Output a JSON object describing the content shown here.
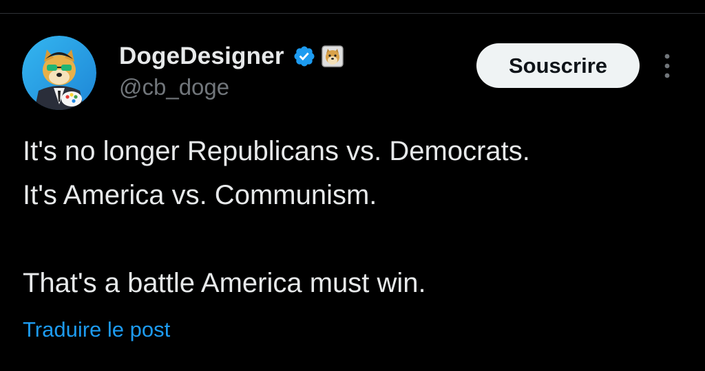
{
  "post": {
    "author": {
      "display_name": "DogeDesigner",
      "handle": "@cb_doge",
      "verified": true,
      "verified_badge_icon": "verified-checkmark-icon",
      "affiliate_badge_icon": "doge-affiliate-icon",
      "avatar_icon": "doge-avatar"
    },
    "subscribe_label": "Souscrire",
    "more_icon": "more-vertical-icon",
    "text_lines": [
      "It's no longer Republicans vs. Democrats.",
      "It's America vs. Communism.",
      "",
      "That's a battle America must win."
    ],
    "translate_label": "Traduire le post"
  },
  "colors": {
    "background": "#000000",
    "text_primary": "#e7e9ea",
    "text_secondary": "#71767b",
    "accent_blue": "#1d9bf0",
    "button_bg": "#eff3f4",
    "button_text": "#0f1419"
  }
}
